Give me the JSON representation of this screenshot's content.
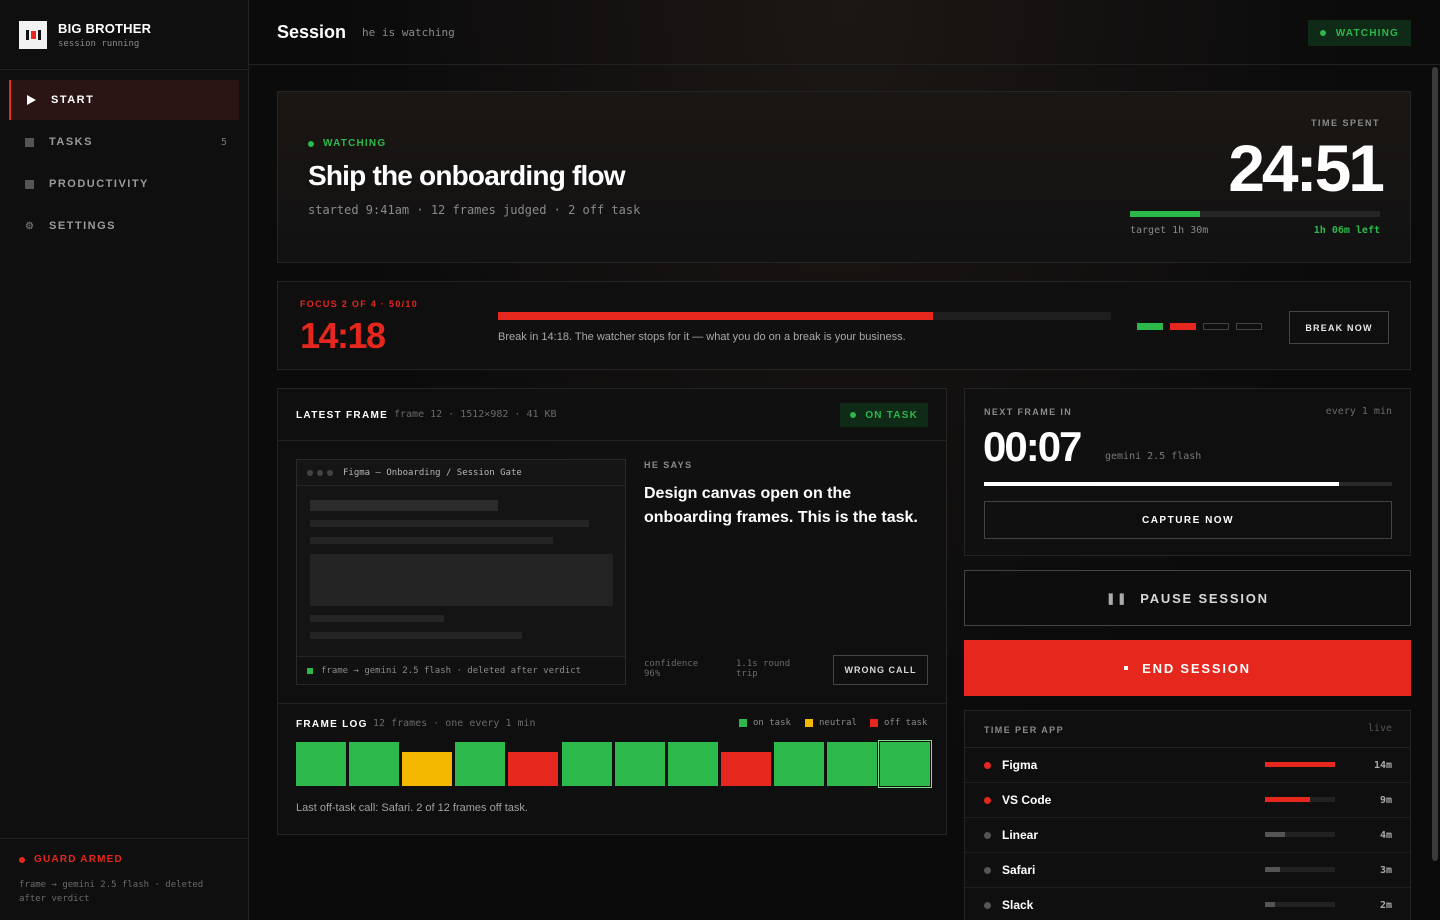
{
  "brand": {
    "title": "BIG BROTHER",
    "subtitle": "session running"
  },
  "nav": [
    {
      "label": "START",
      "icon": "play-icon",
      "active": true
    },
    {
      "label": "TASKS",
      "icon": "tasks-icon",
      "count": "5"
    },
    {
      "label": "PRODUCTIVITY",
      "icon": "productivity-icon"
    },
    {
      "label": "SETTINGS",
      "icon": "gear-icon"
    }
  ],
  "guard": {
    "title": "GUARD ARMED",
    "text": "frame → gemini 2.5 flash · deleted after verdict"
  },
  "header": {
    "title": "Session",
    "subtitle": "he is watching",
    "badge": "WATCHING"
  },
  "hero": {
    "status": "WATCHING",
    "title": "Ship the onboarding flow",
    "meta": "started 9:41am · 12 frames judged · 2 off task",
    "time_label": "TIME SPENT",
    "time_value": "24:51",
    "target": "target 1h 30m",
    "left": "1h 06m left",
    "progress": 0.28
  },
  "focus": {
    "label": "FOCUS 2 OF 4 · 50/10",
    "time": "14:18",
    "progress": 0.71,
    "text": "Break in 14:18. The watcher stops for it — what you do on a break is your business.",
    "segments": [
      "done",
      "current",
      "pending",
      "pending"
    ],
    "break_label": "BREAK NOW"
  },
  "latest": {
    "title": "LATEST FRAME",
    "meta": "frame 12 · 1512×982 · 41 KB",
    "badge": "ON TASK",
    "shot_title": "Figma — Onboarding / Session Gate",
    "shot_foot": "frame → gemini 2.5 flash · deleted after verdict",
    "he_says": "HE SAYS",
    "verdict": "Design canvas open on the onboarding frames. This is the task.",
    "confidence": "confidence 96%",
    "round_trip": "1.1s round trip",
    "wrong_label": "WRONG CALL"
  },
  "frame_log": {
    "title": "FRAME LOG",
    "meta": "12 frames · one every 1 min",
    "legend": {
      "on": "on task",
      "neutral": "neutral",
      "off": "off task"
    },
    "frames": [
      "on",
      "on",
      "neutral",
      "on",
      "off",
      "on",
      "on",
      "on",
      "off",
      "on",
      "on",
      "on-current"
    ],
    "footer": "Last off-task call: Safari. 2 of 12 frames off task."
  },
  "next_frame": {
    "label": "NEXT FRAME IN",
    "every": "every 1 min",
    "time": "00:07",
    "model": "gemini 2.5 flash",
    "progress": 0.87,
    "capture_label": "CAPTURE NOW"
  },
  "pause_label": "PAUSE SESSION",
  "end_label": "END SESSION",
  "apps": {
    "label": "TIME PER APP",
    "live": "live",
    "items": [
      {
        "name": "Figma",
        "minutes": "14m",
        "level": 1.0,
        "color": "#e5271d"
      },
      {
        "name": "VS Code",
        "minutes": "9m",
        "level": 0.64,
        "color": "#e5271d"
      },
      {
        "name": "Linear",
        "minutes": "4m",
        "level": 0.28,
        "color": "#555555"
      },
      {
        "name": "Safari",
        "minutes": "3m",
        "level": 0.21,
        "color": "#555555"
      },
      {
        "name": "Slack",
        "minutes": "2m",
        "level": 0.14,
        "color": "#555555"
      }
    ]
  },
  "colors": {
    "accent": "#e5271d",
    "on_task": "#2db84b",
    "neutral": "#f5b800",
    "off_task": "#e5271d"
  }
}
